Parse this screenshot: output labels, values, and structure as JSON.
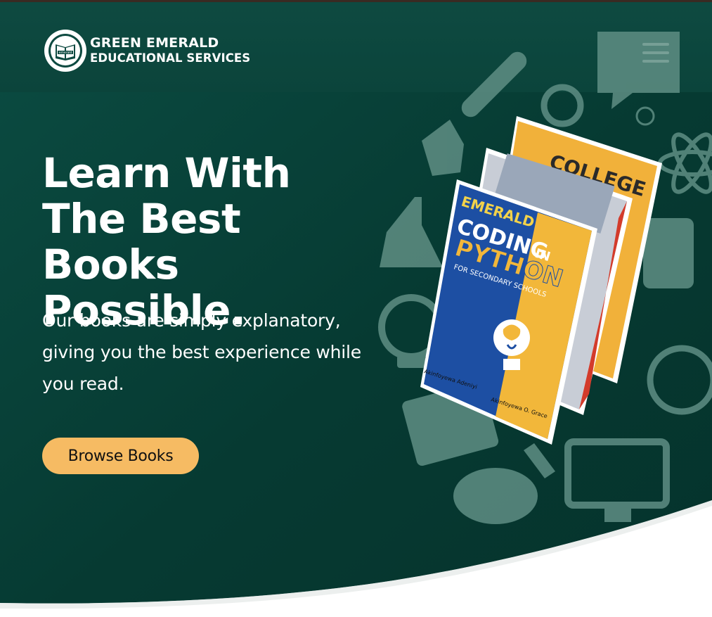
{
  "brand": {
    "line1": "GREEN EMERALD",
    "line2": "EDUCATIONAL SERVICES",
    "emblem_text": "emerald",
    "emblem_top_text": "GREEN EMERALD EDUCATIONAL",
    "emblem_bottom_text": "SERVICES"
  },
  "header": {
    "menu_icon": "hamburger-menu-icon"
  },
  "hero": {
    "headline": "Learn With The Best Books Possible.",
    "subtext": "Our books are simply explanatory, giving you the best experience while you read.",
    "cta_label": "Browse Books"
  },
  "books": {
    "back_title": "COLLEGE",
    "front_brand": "EMERALD",
    "front_title_1": "CODING",
    "front_title_in": "IN",
    "front_title_2": "PYTHON",
    "front_subtitle": "FOR SECONDARY SCHOOLS",
    "author_1": "Akinfoyewa Adeniyi",
    "author_2": "Akinfoyewa O. Grace"
  },
  "colors": {
    "hero_dark": "#06372f",
    "hero_mid": "#0b4a40",
    "cta": "#f6bb63",
    "icon_tint": "#5f8e84",
    "book_blue": "#1d4fa3",
    "book_yellow": "#f2b73a"
  }
}
